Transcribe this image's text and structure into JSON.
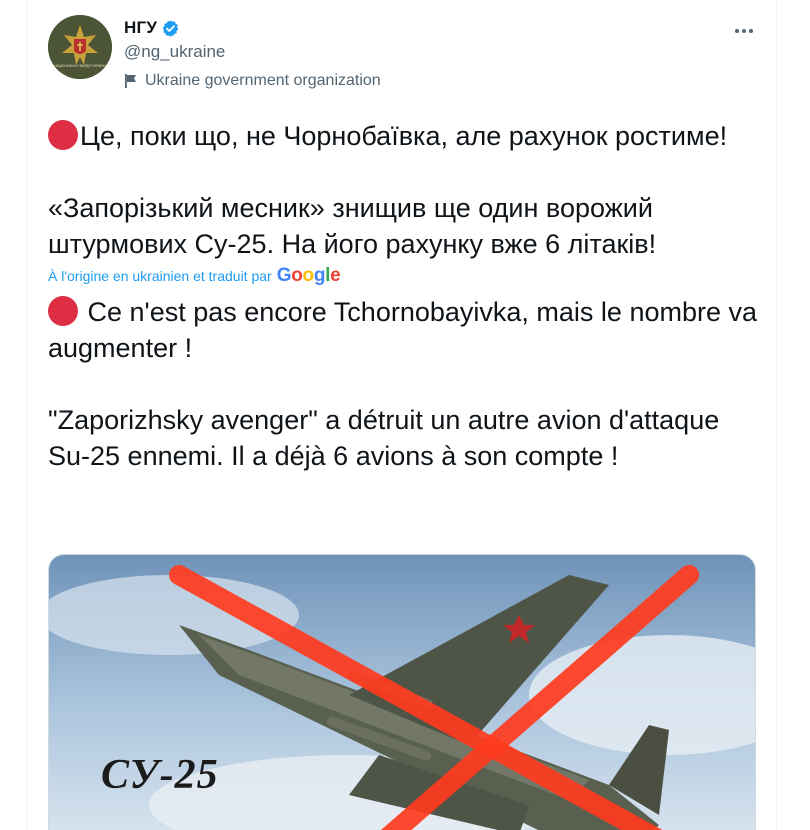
{
  "account": {
    "display_name": "НГУ",
    "handle": "@ng_ukraine",
    "label": "Ukraine government organization",
    "avatar_caption": "НАЦІОНАЛЬНА ГВАРДІЯ УКРАЇНИ"
  },
  "tweet": {
    "original_paragraphs": [
      "Це, поки що, не Чорнобаївка, але рахунок ростиме!",
      "«Запорізький месник» знищив ще один ворожий штурмових Су-25. На його рахунку вже 6 літаків!"
    ],
    "translation_note": "À l'origine en ukrainien et traduit par",
    "translation_provider": "Google",
    "translated_paragraphs": [
      " Ce n'est pas encore Tchornobayivka, mais le nombre va augmenter !",
      " \"Zaporizhsky avenger\" a détruit un autre avion d'attaque Su-25 ennemi. Il a déjà 6 avions à son compte !"
    ]
  },
  "media": {
    "caption": "СУ-25"
  },
  "icons": {
    "verified": "verified-badge-icon",
    "government": "flag-icon",
    "more": "more-icon",
    "emoji": "red-circle-icon"
  },
  "colors": {
    "accent": "#1d9bf0",
    "red_dot": "#dd2e44",
    "strike": "#ff3b1f",
    "secondary_text": "#536471"
  }
}
